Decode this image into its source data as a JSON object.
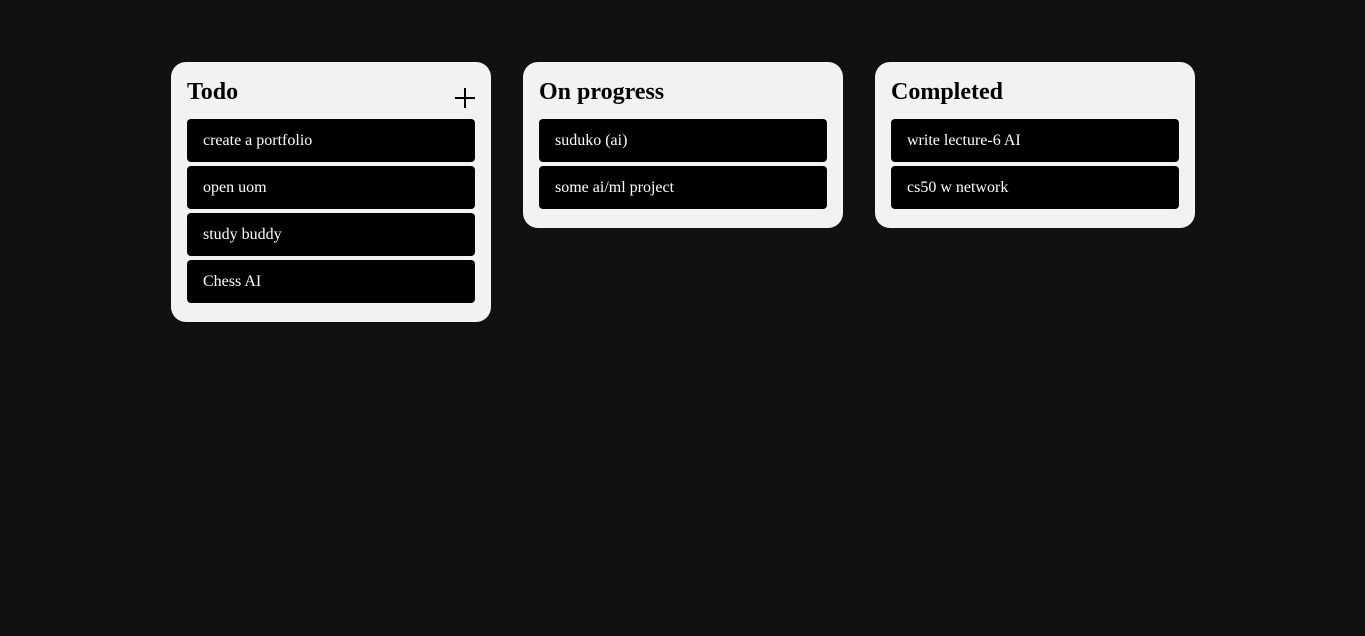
{
  "colors": {
    "background": "#111111",
    "column_background": "#f2f2f2",
    "card_background": "#000000",
    "card_text": "#ffffff"
  },
  "columns": [
    {
      "title": "Todo",
      "add_icon": "plus-icon",
      "add_label": "+",
      "cards": [
        "create a portfolio",
        "open uom",
        "study buddy",
        "Chess AI"
      ]
    },
    {
      "title": "On progress",
      "cards": [
        "suduko (ai)",
        "some ai/ml project"
      ]
    },
    {
      "title": "Completed",
      "cards": [
        "write lecture-6 AI",
        "cs50 w network"
      ]
    }
  ]
}
